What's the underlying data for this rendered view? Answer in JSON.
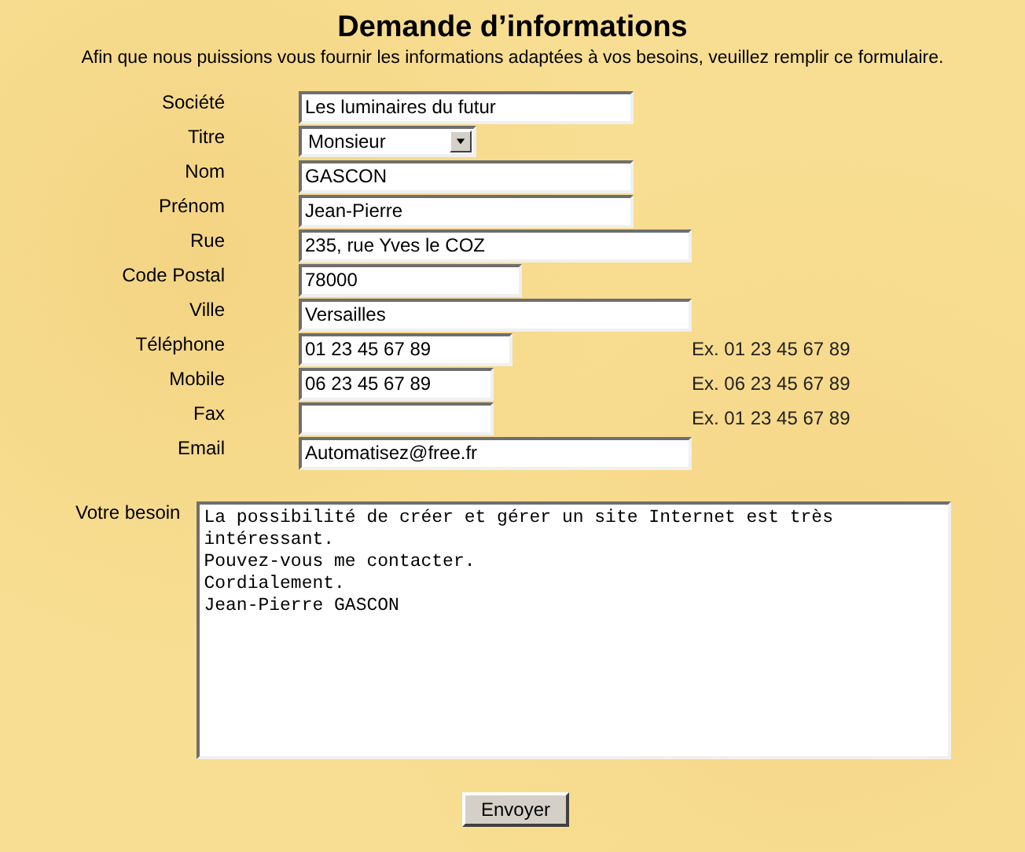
{
  "title": "Demande d’informations",
  "intro": "Afin que nous puissions vous fournir les informations adaptées à vos besoins, veuillez remplir ce formulaire.",
  "fields": [
    {
      "kind": "text",
      "label": "Société",
      "value": "Les luminaires du futur"
    },
    {
      "kind": "select",
      "label": "Titre",
      "value": "Monsieur"
    },
    {
      "kind": "text",
      "label": "Nom",
      "value": "GASCON"
    },
    {
      "kind": "text",
      "label": "Prénom",
      "value": "Jean-Pierre"
    },
    {
      "kind": "text",
      "label": "Rue",
      "value": "235, rue Yves le COZ"
    },
    {
      "kind": "text",
      "label": "Code Postal",
      "value": "78000"
    },
    {
      "kind": "text",
      "label": "Ville",
      "value": "Versailles"
    },
    {
      "kind": "text",
      "label": "Téléphone",
      "value": "01 23 45 67 89",
      "hint": "Ex. 01 23 45 67 89"
    },
    {
      "kind": "text",
      "label": "Mobile",
      "value": "06 23 45 67 89",
      "hint": "Ex. 06 23 45 67 89"
    },
    {
      "kind": "text",
      "label": "Fax",
      "hint": "Ex. 01 23 45 67 89"
    },
    {
      "kind": "text",
      "label": "Email",
      "value": "Automatisez@free.fr"
    }
  ],
  "message": {
    "label": "Votre besoin",
    "value": "La possibilité de créer et gérer un site Internet est très intéressant.\nPouvez-vous me contacter.\nCordialement.\nJean-Pierre GASCON"
  },
  "submit": "Envoyer"
}
